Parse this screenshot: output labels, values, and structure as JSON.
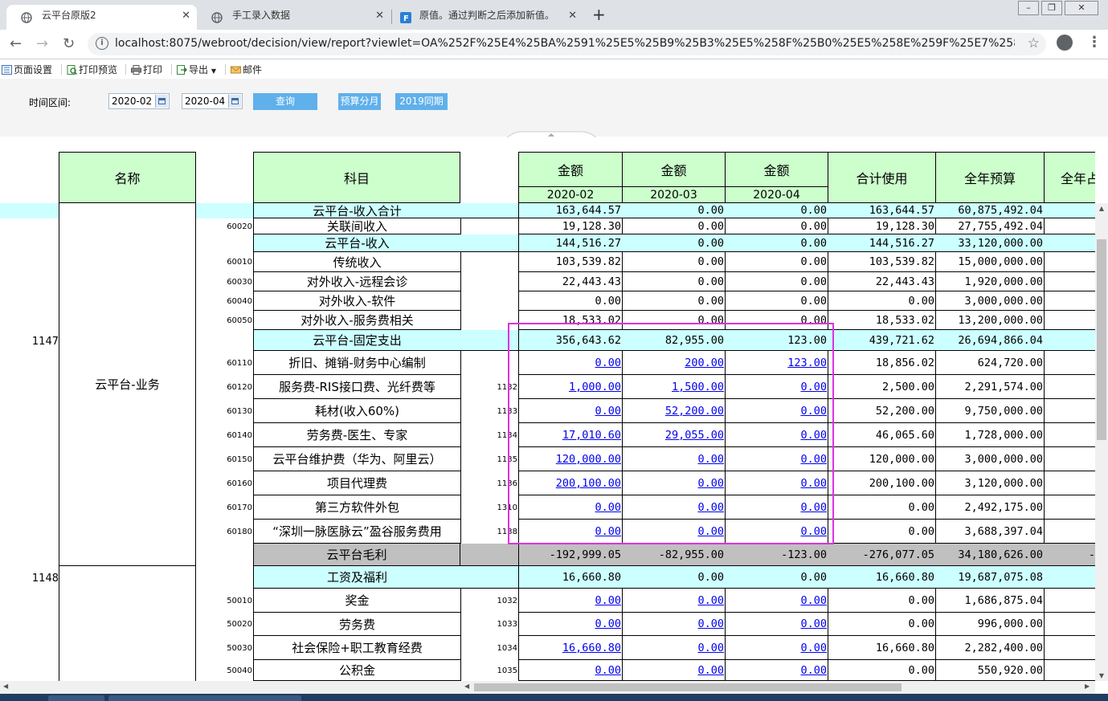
{
  "browser": {
    "tabs": [
      {
        "title": "云平台原版2",
        "active": true
      },
      {
        "title": "手工录入数据",
        "active": false
      },
      {
        "title": "原值。通过判断之后添加新值。",
        "active": false
      }
    ],
    "url": "localhost:8075/webroot/decision/view/report?viewlet=OA%252F%25E4%25BA%2591%25E5%25B9%25B3%25E5%258F%25B0%25E5%258E%259F%25E7%2589%258..."
  },
  "toolbar": {
    "page_setup": "页面设置",
    "print_preview": "打印预览",
    "print": "打印",
    "export": "导出",
    "email": "邮件"
  },
  "params": {
    "range_label": "时间区间:",
    "start": "2020-02",
    "end": "2020-04",
    "query": "查询",
    "budget_btn": "预算分月",
    "last_year_btn": "2019同期"
  },
  "report": {
    "headers": {
      "name": "名称",
      "subject": "科目",
      "amount": "金额",
      "months": [
        "2020-02",
        "2020-03",
        "2020-04"
      ],
      "total_used": "合计使用",
      "annual_budget": "全年预算",
      "annual_ratio": "全年占"
    },
    "groups": [
      {
        "id": "1147",
        "name": "云平台-业务"
      },
      {
        "id": "1148",
        "name": ""
      }
    ],
    "rows": [
      {
        "code": "",
        "label": "云平台-收入合计",
        "sid": "",
        "m1": "163,644.57",
        "m2": "0.00",
        "m3": "0.00",
        "total": "163,644.57",
        "budget": "60,875,492.04"
      },
      {
        "code": "60020",
        "label": "关联间收入",
        "sid": "",
        "m1": "19,128.30",
        "m2": "0.00",
        "m3": "0.00",
        "total": "19,128.30",
        "budget": "27,755,492.04"
      },
      {
        "code": "",
        "label": "云平台-收入",
        "sid": "",
        "m1": "144,516.27",
        "m2": "0.00",
        "m3": "0.00",
        "total": "144,516.27",
        "budget": "33,120,000.00"
      },
      {
        "code": "60010",
        "label": "传统收入",
        "sid": "",
        "m1": "103,539.82",
        "m2": "0.00",
        "m3": "0.00",
        "total": "103,539.82",
        "budget": "15,000,000.00"
      },
      {
        "code": "60030",
        "label": "对外收入-远程会诊",
        "sid": "",
        "m1": "22,443.43",
        "m2": "0.00",
        "m3": "0.00",
        "total": "22,443.43",
        "budget": "1,920,000.00"
      },
      {
        "code": "60040",
        "label": "对外收入-软件",
        "sid": "",
        "m1": "0.00",
        "m2": "0.00",
        "m3": "0.00",
        "total": "0.00",
        "budget": "3,000,000.00"
      },
      {
        "code": "60050",
        "label": "对外收入-服务费相关",
        "sid": "",
        "m1": "18,533.02",
        "m2": "0.00",
        "m3": "0.00",
        "total": "18,533.02",
        "budget": "13,200,000.00"
      },
      {
        "code": "",
        "label": "云平台-固定支出",
        "sid": "",
        "m1": "356,643.62",
        "m2": "82,955.00",
        "m3": "123.00",
        "total": "439,721.62",
        "budget": "26,694,866.04"
      },
      {
        "code": "60110",
        "label": "折旧、摊销-财务中心编制",
        "sid": "",
        "m1": "0.00",
        "m2": "200.00",
        "m3": "123.00",
        "total": "18,856.02",
        "budget": "624,720.00"
      },
      {
        "code": "60120",
        "label": "服务费-RIS接口费、光纤费等",
        "sid": "1132",
        "m1": "1,000.00",
        "m2": "1,500.00",
        "m3": "0.00",
        "total": "2,500.00",
        "budget": "2,291,574.00"
      },
      {
        "code": "60130",
        "label": "耗材(收入60%)",
        "sid": "1133",
        "m1": "0.00",
        "m2": "52,200.00",
        "m3": "0.00",
        "total": "52,200.00",
        "budget": "9,750,000.00"
      },
      {
        "code": "60140",
        "label": "劳务费-医生、专家",
        "sid": "1134",
        "m1": "17,010.60",
        "m2": "29,055.00",
        "m3": "0.00",
        "total": "46,065.60",
        "budget": "1,728,000.00"
      },
      {
        "code": "60150",
        "label": "云平台维护费（华为、阿里云）",
        "sid": "1135",
        "m1": "120,000.00",
        "m2": "0.00",
        "m3": "0.00",
        "total": "120,000.00",
        "budget": "3,000,000.00"
      },
      {
        "code": "60160",
        "label": "项目代理费",
        "sid": "1136",
        "m1": "200,100.00",
        "m2": "0.00",
        "m3": "0.00",
        "total": "200,100.00",
        "budget": "3,120,000.00"
      },
      {
        "code": "60170",
        "label": "第三方软件外包",
        "sid": "1310",
        "m1": "0.00",
        "m2": "0.00",
        "m3": "0.00",
        "total": "0.00",
        "budget": "2,492,175.00"
      },
      {
        "code": "60180",
        "label": "“深圳一脉医脉云”盈谷服务费用",
        "sid": "1138",
        "m1": "0.00",
        "m2": "0.00",
        "m3": "0.00",
        "total": "0.00",
        "budget": "3,688,397.04"
      },
      {
        "code": "",
        "label": "云平台毛利",
        "sid": "",
        "m1": "-192,999.05",
        "m2": "-82,955.00",
        "m3": "-123.00",
        "total": "-276,077.05",
        "budget": "34,180,626.00"
      },
      {
        "code": "",
        "label": "工资及福利",
        "sid": "",
        "m1": "16,660.80",
        "m2": "0.00",
        "m3": "0.00",
        "total": "16,660.80",
        "budget": "19,687,075.08"
      },
      {
        "code": "50010",
        "label": "奖金",
        "sid": "1032",
        "m1": "0.00",
        "m2": "0.00",
        "m3": "0.00",
        "total": "0.00",
        "budget": "1,686,875.04"
      },
      {
        "code": "50020",
        "label": "劳务费",
        "sid": "1033",
        "m1": "0.00",
        "m2": "0.00",
        "m3": "0.00",
        "total": "0.00",
        "budget": "996,000.00"
      },
      {
        "code": "50030",
        "label": "社会保险+职工教育经费",
        "sid": "1034",
        "m1": "16,660.80",
        "m2": "0.00",
        "m3": "0.00",
        "total": "16,660.80",
        "budget": "2,282,400.00"
      },
      {
        "code": "50040",
        "label": "公积金",
        "sid": "1035",
        "m1": "0.00",
        "m2": "0.00",
        "m3": "0.00",
        "total": "0.00",
        "budget": "550,920.00"
      }
    ],
    "gross_profit_ratio_partial": "-"
  }
}
